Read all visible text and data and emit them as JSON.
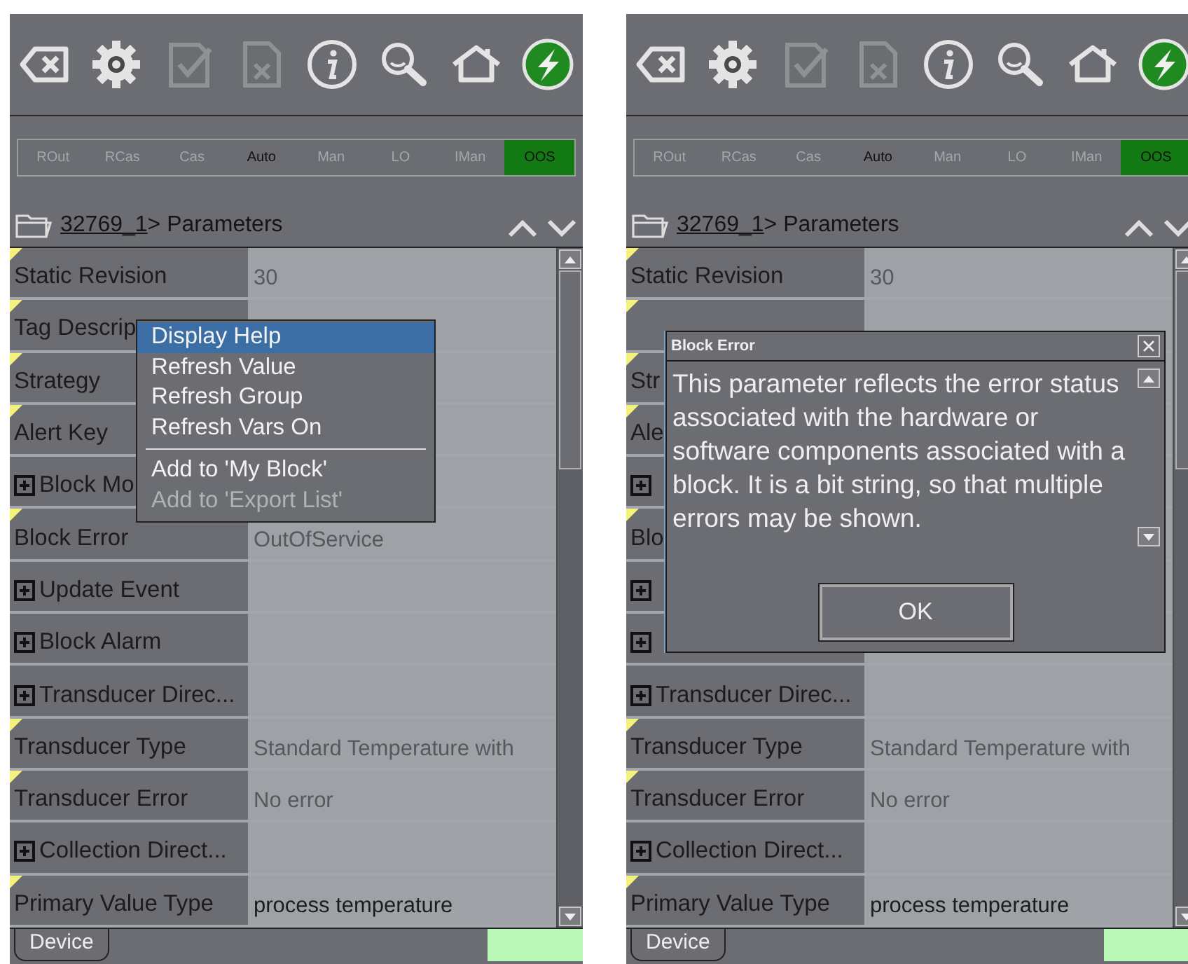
{
  "panels": [
    {
      "toolbar": [
        {
          "kind": "clear",
          "disabled": false
        },
        {
          "kind": "settings",
          "disabled": false
        },
        {
          "kind": "apply",
          "disabled": true
        },
        {
          "kind": "cancel",
          "disabled": true
        },
        {
          "kind": "info",
          "disabled": false
        },
        {
          "kind": "search",
          "disabled": false
        },
        {
          "kind": "home",
          "disabled": false
        },
        {
          "kind": "power",
          "disabled": false
        }
      ],
      "modes": [
        {
          "label": "ROut",
          "active": false,
          "selected": false
        },
        {
          "label": "RCas",
          "active": false,
          "selected": false
        },
        {
          "label": "Cas",
          "active": false,
          "selected": false
        },
        {
          "label": "Auto",
          "active": true,
          "selected": false
        },
        {
          "label": "Man",
          "active": false,
          "selected": false
        },
        {
          "label": "LO",
          "active": false,
          "selected": false
        },
        {
          "label": "IMan",
          "active": false,
          "selected": false
        },
        {
          "label": "OOS",
          "active": false,
          "selected": true
        }
      ],
      "breadcrumb": {
        "link": "32769_1",
        "text": "> Parameters"
      },
      "rows": [
        {
          "kind": "param",
          "label": "Static Revision",
          "value": "30",
          "editable": false
        },
        {
          "kind": "param",
          "label": "Tag Descrip"
        },
        {
          "kind": "param",
          "label": "Strategy"
        },
        {
          "kind": "param",
          "label": "Alert Key"
        },
        {
          "kind": "group",
          "label": "Block Mo"
        },
        {
          "kind": "param",
          "label": "Block Error",
          "value": "OutOfService",
          "editable": false
        },
        {
          "kind": "group",
          "label": "Update Event"
        },
        {
          "kind": "group",
          "label": "Block Alarm"
        },
        {
          "kind": "group",
          "label": "Transducer Direc..."
        },
        {
          "kind": "param",
          "label": "Transducer Type",
          "value": "Standard Temperature with",
          "editable": false
        },
        {
          "kind": "param",
          "label": "Transducer Error",
          "value": "No error",
          "editable": false
        },
        {
          "kind": "group",
          "label": "Collection Direct..."
        },
        {
          "kind": "param",
          "label": "Primary Value Type",
          "value": "process temperature",
          "editable": true
        }
      ],
      "tab": "Device",
      "context_menu": {
        "items": [
          {
            "kind": "item",
            "label": "Display Help",
            "selected": true,
            "disabled": false
          },
          {
            "kind": "item",
            "label": "Refresh Value",
            "selected": false,
            "disabled": false
          },
          {
            "kind": "item",
            "label": "Refresh Group",
            "selected": false,
            "disabled": false
          },
          {
            "kind": "item",
            "label": "Refresh Vars On",
            "selected": false,
            "disabled": false
          },
          {
            "kind": "separator"
          },
          {
            "kind": "item",
            "label": "Add to 'My Block'",
            "selected": false,
            "disabled": false
          },
          {
            "kind": "item",
            "label": "Add to 'Export List'",
            "selected": false,
            "disabled": true
          }
        ]
      }
    },
    {
      "toolbar": [
        {
          "kind": "clear",
          "disabled": false
        },
        {
          "kind": "settings",
          "disabled": false
        },
        {
          "kind": "apply",
          "disabled": true
        },
        {
          "kind": "cancel",
          "disabled": true
        },
        {
          "kind": "info",
          "disabled": false
        },
        {
          "kind": "search",
          "disabled": false
        },
        {
          "kind": "home",
          "disabled": false
        },
        {
          "kind": "power",
          "disabled": false
        }
      ],
      "modes": [
        {
          "label": "ROut",
          "active": false,
          "selected": false
        },
        {
          "label": "RCas",
          "active": false,
          "selected": false
        },
        {
          "label": "Cas",
          "active": false,
          "selected": false
        },
        {
          "label": "Auto",
          "active": true,
          "selected": false
        },
        {
          "label": "Man",
          "active": false,
          "selected": false
        },
        {
          "label": "LO",
          "active": false,
          "selected": false
        },
        {
          "label": "IMan",
          "active": false,
          "selected": false
        },
        {
          "label": "OOS",
          "active": false,
          "selected": true
        }
      ],
      "breadcrumb": {
        "link": "32769_1",
        "text": "> Parameters"
      },
      "rows": [
        {
          "kind": "param",
          "label": "Static Revision",
          "value": "30",
          "editable": false
        },
        {
          "kind": "param"
        },
        {
          "kind": "param",
          "label": "Str"
        },
        {
          "kind": "param",
          "label": "Ale"
        },
        {
          "kind": "group"
        },
        {
          "kind": "param",
          "label": "Blo"
        },
        {
          "kind": "group"
        },
        {
          "kind": "group"
        },
        {
          "kind": "group",
          "label": "Transducer Direc..."
        },
        {
          "kind": "param",
          "label": "Transducer Type",
          "value": "Standard Temperature with",
          "editable": false
        },
        {
          "kind": "param",
          "label": "Transducer Error",
          "value": "No error",
          "editable": false
        },
        {
          "kind": "group",
          "label": "Collection Direct..."
        },
        {
          "kind": "param",
          "label": "Primary Value Type",
          "value": "process temperature",
          "editable": true
        }
      ],
      "tab": "Device",
      "dialog": {
        "title": "Block Error",
        "text": "This parameter reflects the error status associated with the hardware or software components associated with a block. It is a bit string, so that multiple errors may be shown.",
        "button": "OK"
      }
    }
  ]
}
